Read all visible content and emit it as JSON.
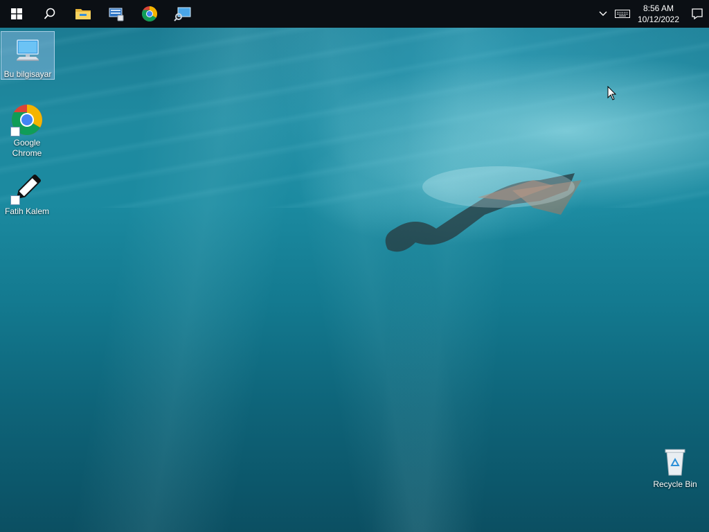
{
  "taskbar": {
    "items": [
      {
        "name": "start",
        "icon": "windows-logo-icon"
      },
      {
        "name": "search",
        "icon": "search-icon"
      },
      {
        "name": "file-explorer",
        "icon": "folder-icon"
      },
      {
        "name": "server-manager",
        "icon": "server-manager-icon"
      },
      {
        "name": "chrome",
        "icon": "chrome-icon"
      },
      {
        "name": "network",
        "icon": "network-monitor-icon"
      }
    ],
    "tray": {
      "overflow_icon": "chevron-up-icon",
      "keyboard_icon": "keyboard-icon",
      "time": "8:56 AM",
      "date": "10/12/2022",
      "notification_icon": "action-center-icon"
    }
  },
  "desktop": {
    "icons": [
      {
        "label": "Bu bilgisayar",
        "icon": "computer-icon"
      },
      {
        "label": "Google Chrome",
        "icon": "chrome-icon"
      },
      {
        "label": "Fatih Kalem",
        "icon": "pen-icon"
      },
      {
        "label": "Recycle Bin",
        "icon": "recycle-bin-icon"
      }
    ]
  },
  "colors": {
    "taskbar_bg": "#0b0f14",
    "water_top": "#1c7c93",
    "water_bottom": "#0b4f62",
    "selection": "#96bee6"
  }
}
